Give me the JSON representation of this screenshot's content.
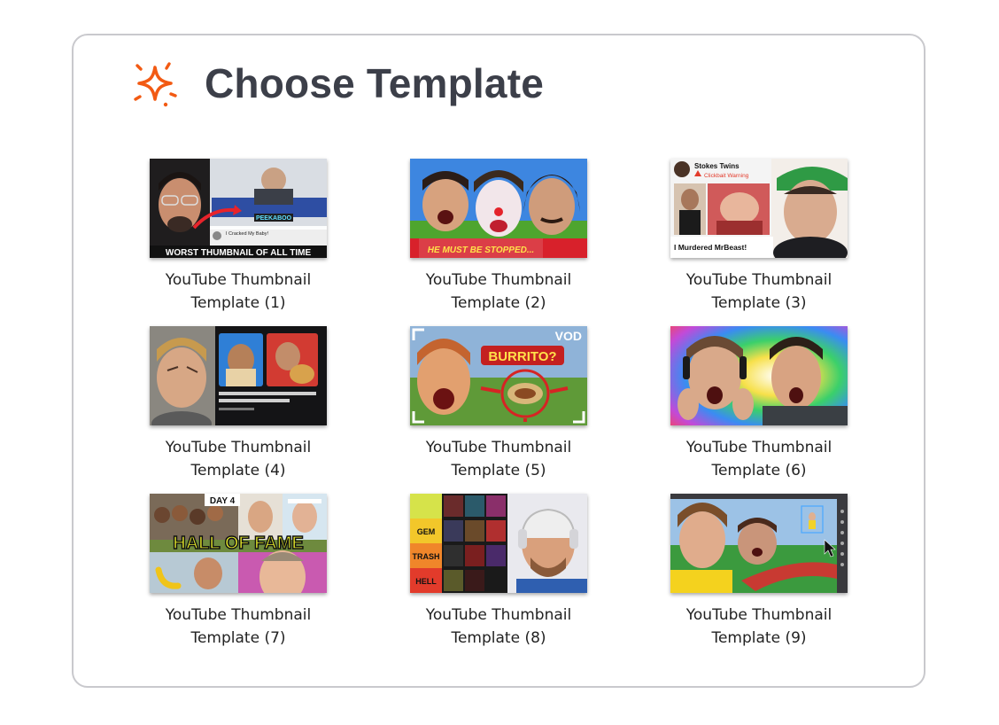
{
  "header": {
    "title": "Choose Template",
    "icon": "sparkle-icon",
    "icon_color": "#f25a13"
  },
  "templates": [
    {
      "label": "YouTube Thumbnail\nTemplate  (1)",
      "overlay": "WORST THUMBNAIL OF ALL TIME",
      "tag": "PEEKABOO",
      "sub": "I Cracked My Baby!"
    },
    {
      "label": "YouTube Thumbnail\nTemplate  (2)",
      "overlay": "HE MUST BE STOPPED..."
    },
    {
      "label": "YouTube Thumbnail\nTemplate  (3)",
      "channel": "Stokes Twins",
      "warning": "Clickbait Warning",
      "overlay": "I Murdered MrBeast!"
    },
    {
      "label": "YouTube Thumbnail\nTemplate  (4)"
    },
    {
      "label": "YouTube Thumbnail\nTemplate  (5)",
      "overlay": "BURRITO?",
      "tag": "VOD"
    },
    {
      "label": "YouTube Thumbnail\nTemplate  (6)"
    },
    {
      "label": "YouTube Thumbnail\nTemplate  (7)",
      "overlay": "HALL OF FAME",
      "tag": "DAY 4"
    },
    {
      "label": "YouTube Thumbnail\nTemplate  (8)",
      "tiers": [
        "GEM",
        "TRASH",
        "HELL"
      ]
    },
    {
      "label": "YouTube Thumbnail\nTemplate  (9)"
    }
  ]
}
